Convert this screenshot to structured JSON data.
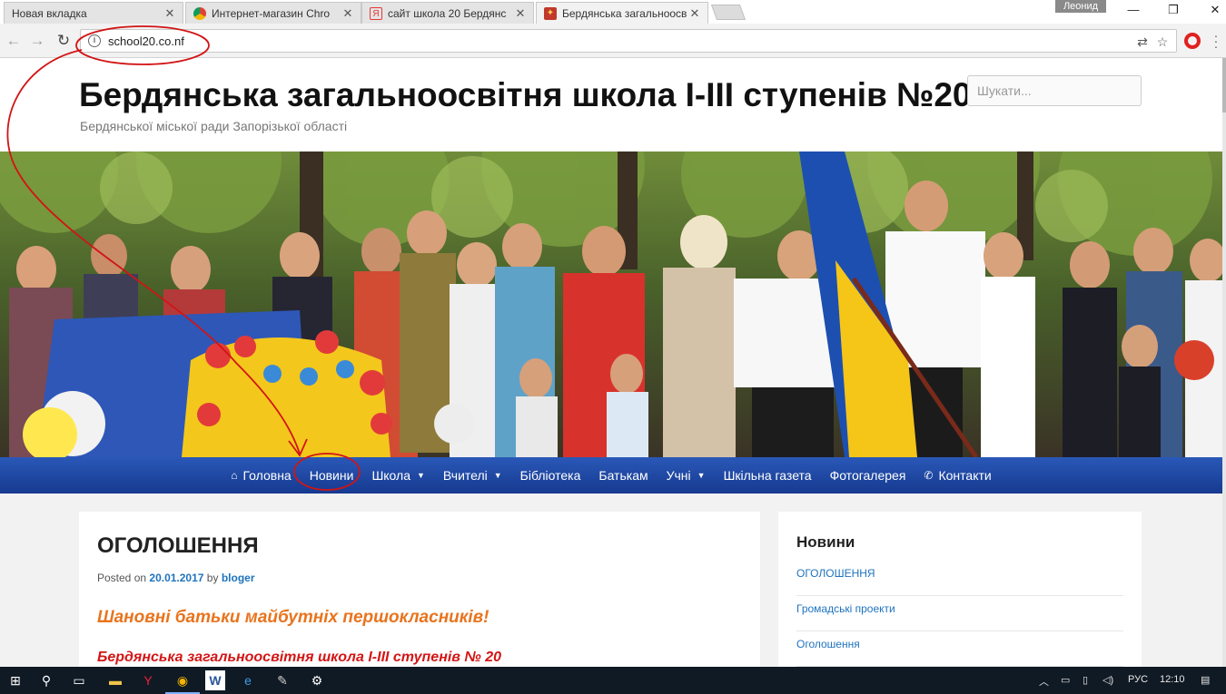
{
  "browser": {
    "tabs": [
      {
        "title": "Новая вкладка"
      },
      {
        "title": "Интернет-магазин Chro"
      },
      {
        "title": "сайт школа 20 Бердянс"
      },
      {
        "title": "Бердянська загальноосв"
      }
    ],
    "user_name": "Леонид",
    "url": "school20.co.nf"
  },
  "site": {
    "title": "Бердянська загальноосвітня школа I-III ступенів №20",
    "description": "Бердянської міської ради Запорізької області",
    "search_placeholder": "Шукати..."
  },
  "nav": {
    "items": [
      {
        "label": "Головна",
        "icon": "home-icon"
      },
      {
        "label": "Новини"
      },
      {
        "label": "Школа",
        "dropdown": true
      },
      {
        "label": "Вчителі",
        "dropdown": true
      },
      {
        "label": "Бібліотека"
      },
      {
        "label": "Батькам"
      },
      {
        "label": "Учні",
        "dropdown": true
      },
      {
        "label": "Шкільна газета"
      },
      {
        "label": "Фотогалерея"
      },
      {
        "label": "Контакти",
        "icon": "phone-icon"
      }
    ]
  },
  "post": {
    "title": "ОГОЛОШЕННЯ",
    "posted_on": "Posted on",
    "date": "20.01.2017",
    "by": "by",
    "author": "bloger",
    "lead": "Шановні батьки майбутніх першокласників!",
    "subtitle": "Бердянська загальноосвітня школа І-ІІІ ступенів № 20"
  },
  "sidebar": {
    "title": "Новини",
    "items": [
      {
        "label": "ОГОЛОШЕННЯ"
      },
      {
        "label": "Громадські проекти"
      },
      {
        "label": "Оголошення"
      }
    ]
  },
  "taskbar": {
    "language": "РУС",
    "time": "12:10"
  },
  "colors": {
    "nav_bar": "#1f4aa8",
    "link": "#1e73be",
    "lead_text": "#e8741e",
    "subtitle_text": "#d41616",
    "annotation": "#d21414"
  }
}
